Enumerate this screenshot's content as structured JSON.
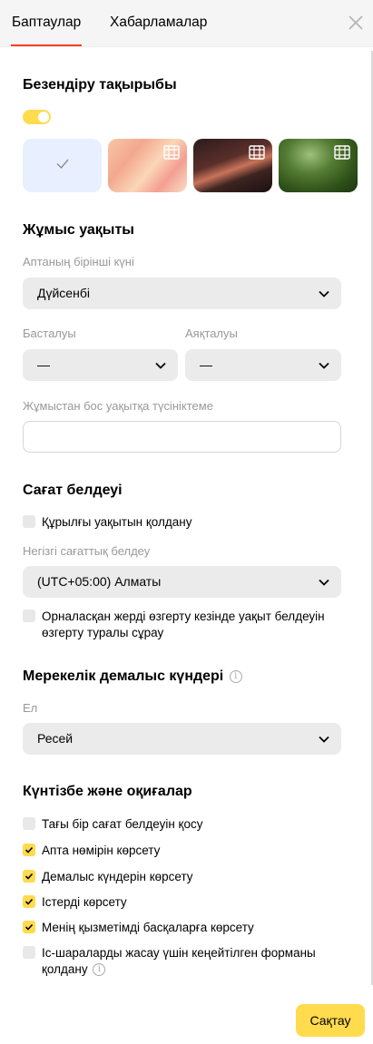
{
  "tabs": {
    "settings": "Баптаулар",
    "notifications": "Хабарламалар"
  },
  "theme_section": {
    "title": "Безендіру тақырыбы",
    "toggle_on": true
  },
  "work_time": {
    "title": "Жұмыс уақыты",
    "first_day_label": "Аптаның бірінші күні",
    "first_day_value": "Дүйсенбі",
    "start_label": "Басталуы",
    "start_value": "—",
    "end_label": "Аяқталуы",
    "end_value": "—",
    "comment_label": "Жұмыстан бос уақытқа түсініктеме",
    "comment_value": ""
  },
  "timezone": {
    "title": "Сағат белдеуі",
    "use_device": "Құрылғы уақытын қолдану",
    "main_label": "Негізгі сағаттық белдеу",
    "main_value": "(UTC+05:00) Алматы",
    "ask_change": "Орналасқан жерді өзгерту кезінде уақыт белдеуін өзгерту туралы сұрау"
  },
  "holidays": {
    "title": "Мерекелік демалыс күндері",
    "country_label": "Ел",
    "country_value": "Ресей"
  },
  "calendar": {
    "title": "Күнтізбе және оқиғалар",
    "options": [
      {
        "label": "Тағы бір сағат белдеуін қосу",
        "checked": false
      },
      {
        "label": "Апта нөмірін көрсету",
        "checked": true
      },
      {
        "label": "Демалыс күндерін көрсету",
        "checked": true
      },
      {
        "label": "Істерді көрсету",
        "checked": true
      },
      {
        "label": "Менің қызметімді басқаларға көрсету",
        "checked": true
      },
      {
        "label": "Іс-шараларды жасау үшін кеңейтілген форманы қолдану",
        "checked": false
      }
    ]
  },
  "save_label": "Сақтау",
  "colors": {
    "accent": "#ffdb4d",
    "tab_underline": "#fc3f1d",
    "field_bg": "#ebebeb"
  }
}
